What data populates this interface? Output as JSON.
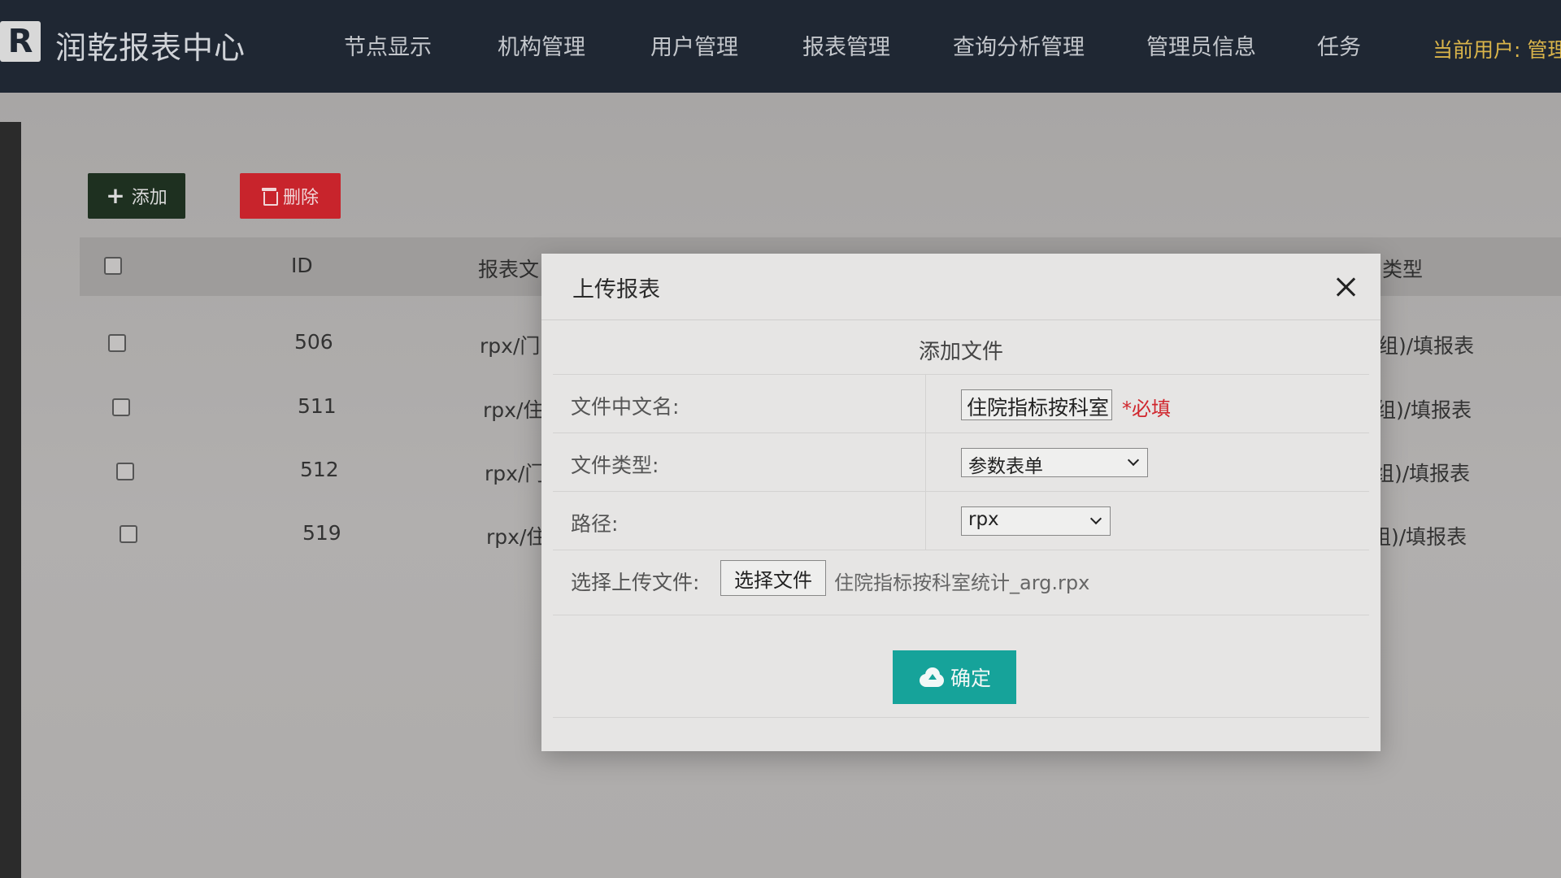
{
  "header": {
    "logo_text": "R",
    "brand": "润乾报表中心",
    "nav": [
      "节点显示",
      "机构管理",
      "用户管理",
      "报表管理",
      "查询分析管理",
      "管理员信息",
      "任务"
    ],
    "current_user": "当前用户: 管理"
  },
  "toolbar": {
    "add_label": "添加",
    "delete_label": "删除"
  },
  "table": {
    "columns": {
      "id": "ID",
      "name": "报表文",
      "type": "类型"
    },
    "rows": [
      {
        "id": "506",
        "name": "rpx/门i",
        "type": "组)/填报表"
      },
      {
        "id": "511",
        "name": "rpx/住l",
        "type": "组)/填报表"
      },
      {
        "id": "512",
        "name": "rpx/门i",
        "type": "组)/填报表"
      },
      {
        "id": "519",
        "name": "rpx/住l",
        "type": "组)/填报表"
      }
    ]
  },
  "modal": {
    "title": "上传报表",
    "section_title": "添加文件",
    "fields": {
      "name_label": "文件中文名:",
      "name_value": "住院指标按科室",
      "required_text": "*必填",
      "type_label": "文件类型:",
      "type_value": "参数表单",
      "path_label": "路径:",
      "path_value": "rpx",
      "upload_label": "选择上传文件:",
      "choose_file_button": "选择文件",
      "chosen_file": "住院指标按科室统计_arg.rpx"
    },
    "confirm_label": "确定"
  },
  "colors": {
    "topbar": "#1f2733",
    "delete_button": "#c8242c",
    "confirm_button": "#16a39a",
    "required_text": "#d0272e",
    "current_user": "#d9b44a"
  }
}
